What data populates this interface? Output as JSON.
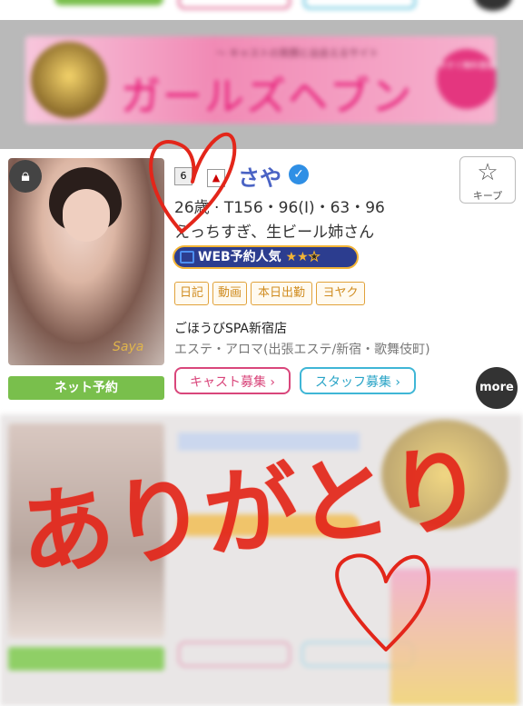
{
  "banner": {
    "sub_text": "〜 キャストの笑顔と出会えるサイト",
    "title": "ガールズヘブン",
    "badge_text": "今すぐ無料登録"
  },
  "cast": {
    "rank": "6",
    "name": "さや",
    "spec": "26歳 · T156・96(I)・63・96",
    "catch_copy": "えっちすぎ、生ビール姉さん",
    "popularity_label": "WEB予約人気",
    "popularity_stars": 2,
    "popularity_stars_max": 3,
    "tags": [
      "日記",
      "動画",
      "本日出勤",
      "ヨヤク"
    ],
    "shop": "ごほうびSPA新宿店",
    "category": "エステ・アロマ(出張エステ/新宿・歌舞伎町)",
    "net_reserve_label": "ネット予約",
    "cast_recruit_label": "キャスト募集 ›",
    "staff_recruit_label": "スタッフ募集 ›",
    "keep_label": "キープ",
    "more_label": "more"
  },
  "handwriting": {
    "text": "ありがとり"
  },
  "colors": {
    "name_blue": "#4a63c4",
    "tag_orange": "#e1a23a",
    "net_green": "#79bf4c",
    "cast_pink": "#d9467b",
    "staff_cyan": "#3fb6d6",
    "ink_red": "#e3261a"
  }
}
